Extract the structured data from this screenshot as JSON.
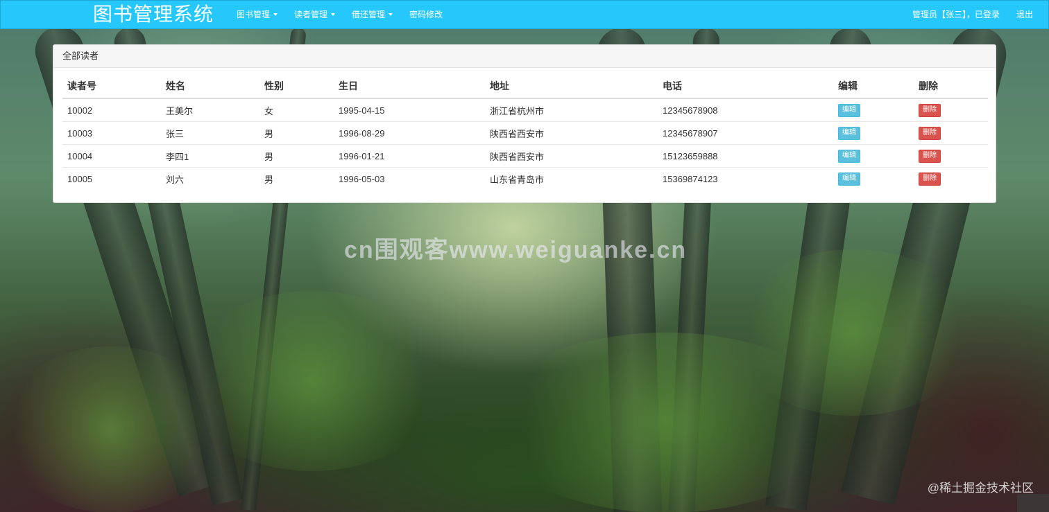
{
  "navbar": {
    "brand": "图书管理系统",
    "menus": [
      {
        "label": "图书管理",
        "has_caret": true
      },
      {
        "label": "读者管理",
        "has_caret": true
      },
      {
        "label": "借还管理",
        "has_caret": true
      },
      {
        "label": "密码修改",
        "has_caret": false
      }
    ],
    "user_status": "管理员【张三】，已登录",
    "logout": "退出",
    "color": "#26c8fb"
  },
  "panel": {
    "title": "全部读者",
    "columns": [
      "读者号",
      "姓名",
      "性别",
      "生日",
      "地址",
      "电话",
      "编辑",
      "删除"
    ],
    "rows": [
      {
        "id": "10002",
        "name": "王美尔",
        "gender": "女",
        "birthday": "1995-04-15",
        "address": "浙江省杭州市",
        "phone": "12345678908"
      },
      {
        "id": "10003",
        "name": "张三",
        "gender": "男",
        "birthday": "1996-08-29",
        "address": "陕西省西安市",
        "phone": "12345678907"
      },
      {
        "id": "10004",
        "name": "李四1",
        "gender": "男",
        "birthday": "1996-01-21",
        "address": "陕西省西安市",
        "phone": "15123659888"
      },
      {
        "id": "10005",
        "name": "刘六",
        "gender": "男",
        "birthday": "1996-05-03",
        "address": "山东省青岛市",
        "phone": "15369874123"
      }
    ],
    "edit_label": "编辑",
    "delete_label": "删除",
    "edit_color": "#5bc0de",
    "delete_color": "#d9534f"
  },
  "watermarks": {
    "center": "cn围观客www.weiguanke.cn",
    "corner": "@稀土掘金技术社区"
  }
}
